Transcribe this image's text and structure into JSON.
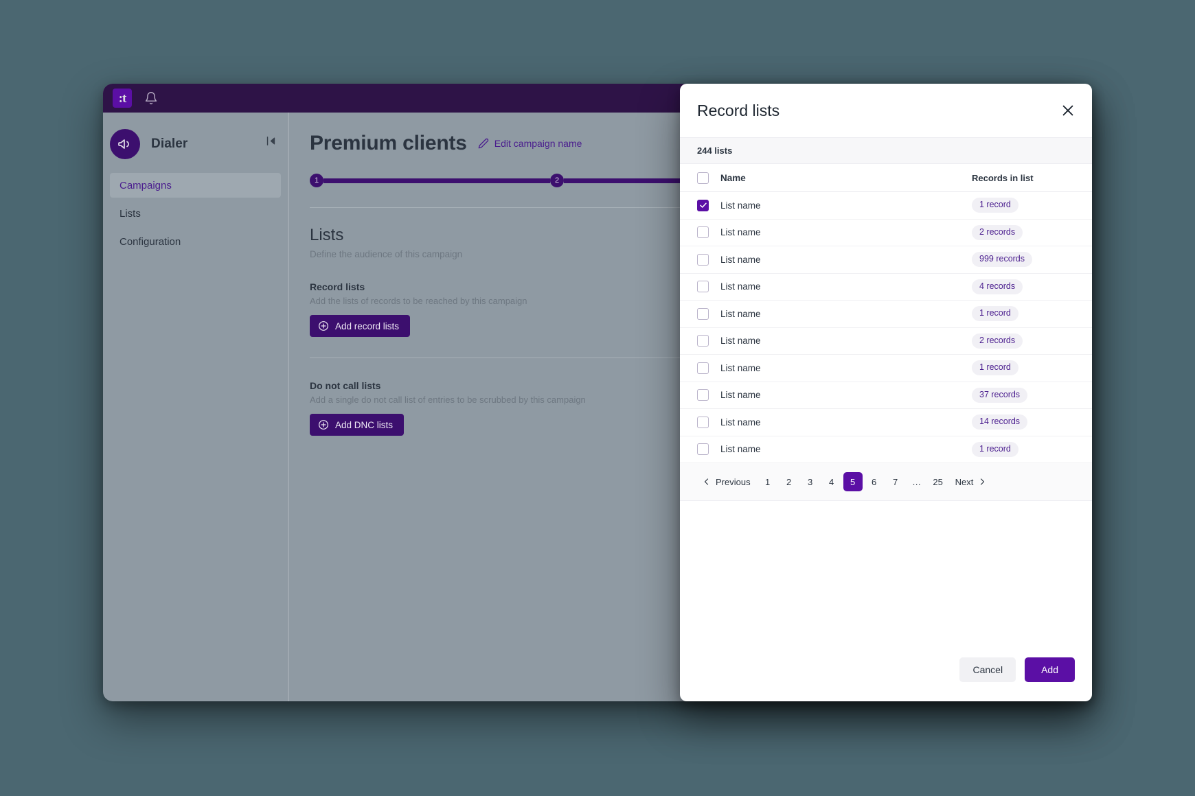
{
  "colors": {
    "page_background": "#4b6771",
    "brand_purple": "#5b0fa5",
    "dark_purple": "#3c0f6e",
    "topbar": "#2e1347",
    "app_surface": "#8f9aa3"
  },
  "topbar": {
    "logo_glyph": ":t",
    "logo_icon": "brand-logo-icon",
    "bell_icon": "notification-bell-icon"
  },
  "sidebar": {
    "avatar_icon": "megaphone-icon",
    "title": "Dialer",
    "collapse_icon": "collapse-sidebar-icon",
    "items": [
      {
        "label": "Campaigns",
        "active": true
      },
      {
        "label": "Lists",
        "active": false
      },
      {
        "label": "Configuration",
        "active": false
      }
    ]
  },
  "main": {
    "campaign_name": "Premium clients",
    "edit_link": "Edit campaign name",
    "edit_icon": "pencil-icon",
    "stepper": {
      "steps": [
        "1",
        "2"
      ]
    },
    "section": {
      "heading": "Lists",
      "subheading": "Define the audience of this campaign"
    },
    "blocks": [
      {
        "title": "Record lists",
        "description": "Add the lists of records to be reached by this campaign",
        "button_label": "Add record lists",
        "button_icon": "plus-circle-icon"
      },
      {
        "title": "Do not call lists",
        "description": "Add a single do not call list of entries to be scrubbed by this campaign",
        "button_label": "Add DNC lists",
        "button_icon": "plus-circle-icon"
      }
    ]
  },
  "modal": {
    "title": "Record lists",
    "close_icon": "close-icon",
    "count_label": "244 lists",
    "table": {
      "headers": {
        "name": "Name",
        "records": "Records in list"
      },
      "rows": [
        {
          "name": "List name",
          "records": "1 record",
          "checked": true
        },
        {
          "name": "List name",
          "records": "2 records",
          "checked": false
        },
        {
          "name": "List name",
          "records": "999 records",
          "checked": false
        },
        {
          "name": "List name",
          "records": "4 records",
          "checked": false
        },
        {
          "name": "List name",
          "records": "1 record",
          "checked": false
        },
        {
          "name": "List name",
          "records": "2 records",
          "checked": false
        },
        {
          "name": "List name",
          "records": "1 record",
          "checked": false
        },
        {
          "name": "List name",
          "records": "37 records",
          "checked": false
        },
        {
          "name": "List name",
          "records": "14 records",
          "checked": false
        },
        {
          "name": "List name",
          "records": "1 record",
          "checked": false
        }
      ]
    },
    "pagination": {
      "previous_label": "Previous",
      "next_label": "Next",
      "pages": [
        "1",
        "2",
        "3",
        "4",
        "5",
        "6",
        "7",
        "…",
        "25"
      ],
      "current_page": "5"
    },
    "footer": {
      "cancel_label": "Cancel",
      "add_label": "Add"
    }
  }
}
